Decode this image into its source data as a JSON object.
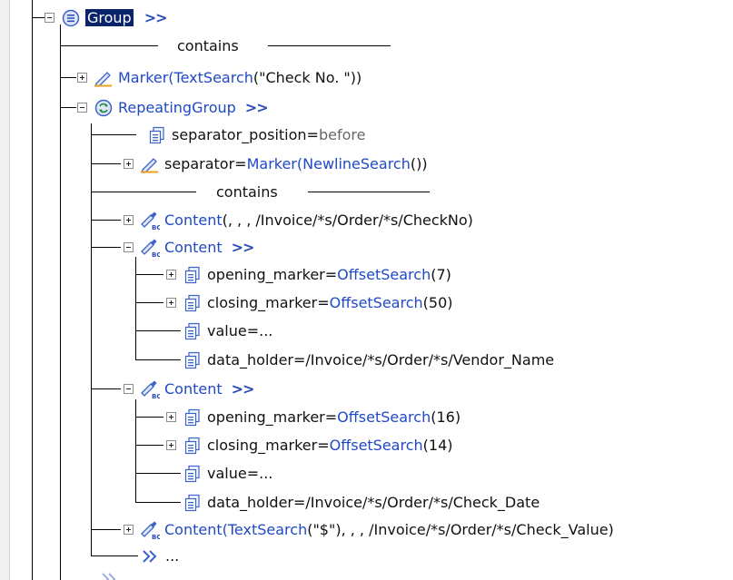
{
  "tree": {
    "group": {
      "label": "Group",
      "suffix": ">>"
    },
    "contains_label": "contains",
    "marker_check": {
      "prefix": "Marker(",
      "func": "TextSearch",
      "args": "(\"Check No. \"))"
    },
    "repeating_group": {
      "label": "RepeatingGroup",
      "suffix": ">>"
    },
    "separator_position": {
      "name": "separator_position",
      "eq": " = ",
      "value": "before"
    },
    "separator": {
      "name": "separator",
      "eq": " = ",
      "prefix": "Marker(",
      "func": "NewlineSearch",
      "args": "())"
    },
    "contains_inner_label": "contains",
    "content1": {
      "name": "Content",
      "args": "(, , , /Invoice/*s/Order/*s/CheckNo)"
    },
    "content2": {
      "name": "Content",
      "suffix": ">>",
      "opening_marker": {
        "name": "opening_marker",
        "eq": " = ",
        "func": "OffsetSearch",
        "args": "(7)"
      },
      "closing_marker": {
        "name": "closing_marker",
        "eq": " = ",
        "func": "OffsetSearch",
        "args": "(50)"
      },
      "value": {
        "name": "value",
        "eq": " = ",
        "val": "..."
      },
      "data_holder": {
        "name": "data_holder",
        "eq": " = ",
        "val": "/Invoice/*s/Order/*s/Vendor_Name"
      }
    },
    "content3": {
      "name": "Content",
      "suffix": ">>",
      "opening_marker": {
        "name": "opening_marker",
        "eq": " = ",
        "func": "OffsetSearch",
        "args": "(16)"
      },
      "closing_marker": {
        "name": "closing_marker",
        "eq": " = ",
        "func": "OffsetSearch",
        "args": "(14)"
      },
      "value": {
        "name": "value",
        "eq": " = ",
        "val": "..."
      },
      "data_holder": {
        "name": "data_holder",
        "eq": " = ",
        "val": "/Invoice/*s/Order/*s/Check_Date"
      }
    },
    "content4": {
      "name": "Content(",
      "func": "TextSearch",
      "args": "(\"$\"), , , /Invoice/*s/Order/*s/Check_Value)"
    },
    "more": {
      "label": "..."
    }
  },
  "icons": {
    "group": "group-list-icon",
    "marker": "pencil-marker-icon",
    "repeating": "repeating-group-icon",
    "property": "property-sheet-icon",
    "content": "content-wand-icon",
    "more": "more-chevron-icon"
  },
  "colors": {
    "link": "#1f49c7",
    "args": "#17832c",
    "selection": "#0a246a"
  }
}
